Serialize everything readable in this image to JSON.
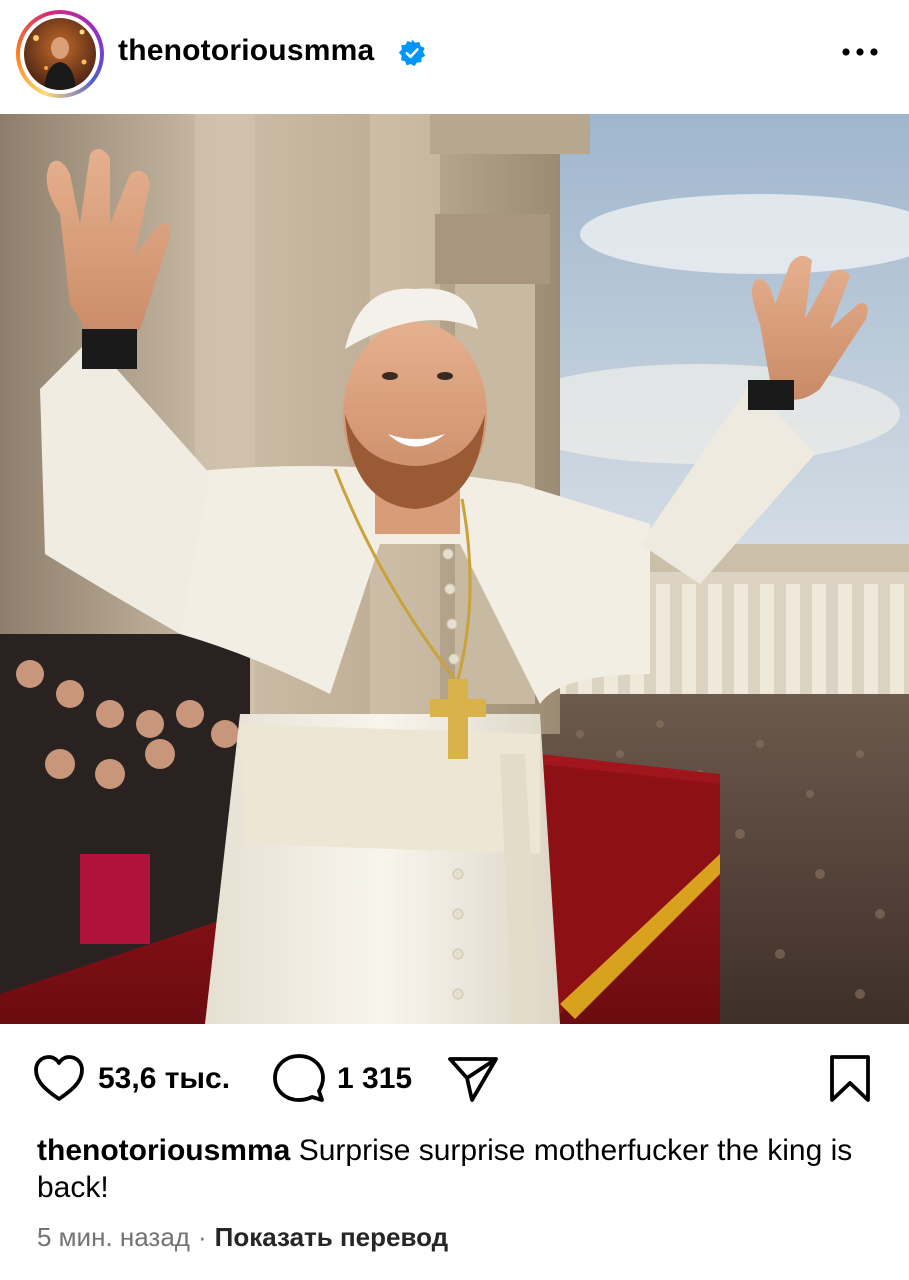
{
  "header": {
    "username": "thenotoriousmma",
    "avatar_icon": "profile-avatar",
    "verified_icon": "verified-badge-icon",
    "more_icon": "more-options-icon",
    "verified_color": "#0095F6"
  },
  "post": {
    "image_icon": "post-photo"
  },
  "actions": {
    "like_icon": "heart-icon",
    "like_count": "53,6 тыс.",
    "comment_icon": "comment-icon",
    "comment_count": "1 315",
    "share_icon": "paper-plane-icon",
    "save_icon": "bookmark-icon"
  },
  "caption": {
    "username": "thenotoriousmma",
    "text": "Surprise surprise motherfucker the king is back!"
  },
  "meta": {
    "time": "5 мин. назад",
    "separator": "·",
    "translate_label": "Показать перевод",
    "time_color": "#737373"
  }
}
